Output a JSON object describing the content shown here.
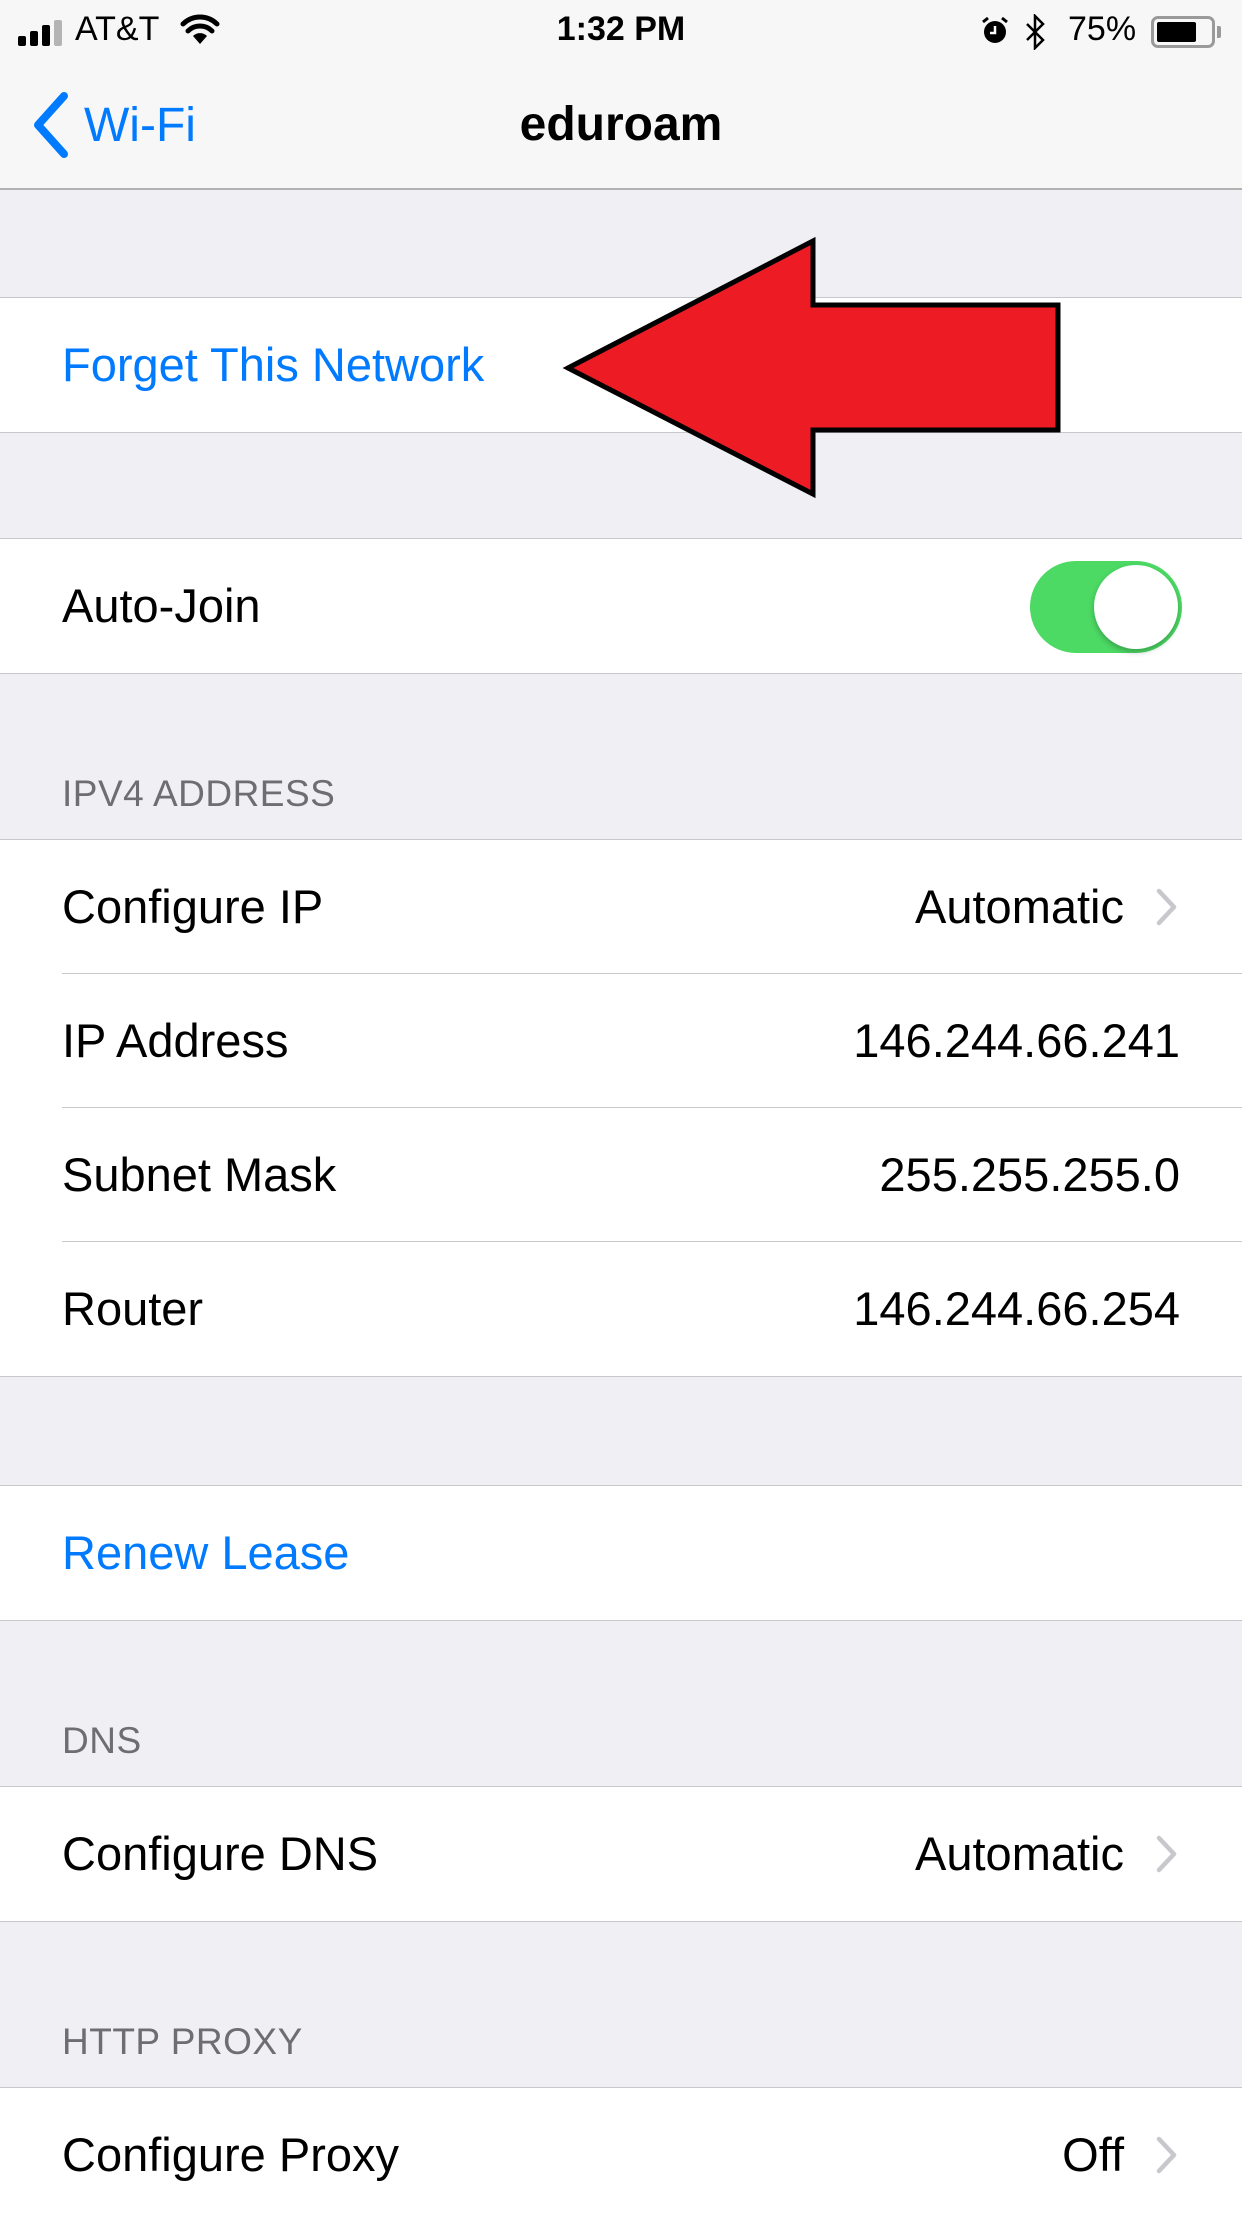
{
  "status_bar": {
    "carrier": "AT&T",
    "time": "1:32 PM",
    "battery_percent": "75%",
    "signal_bars": 3,
    "signal_bars_total": 4,
    "battery_level": 0.75
  },
  "nav": {
    "back_label": "Wi-Fi",
    "title": "eduroam"
  },
  "actions": {
    "forget_network": "Forget This Network",
    "renew_lease": "Renew Lease"
  },
  "auto_join": {
    "label": "Auto-Join",
    "enabled": true
  },
  "ipv4": {
    "header": "IPV4 ADDRESS",
    "rows": [
      {
        "label": "Configure IP",
        "value": "Automatic"
      },
      {
        "label": "IP Address",
        "value": "146.244.66.241"
      },
      {
        "label": "Subnet Mask",
        "value": "255.255.255.0"
      },
      {
        "label": "Router",
        "value": "146.244.66.254"
      }
    ]
  },
  "dns": {
    "header": "DNS",
    "rows": [
      {
        "label": "Configure DNS",
        "value": "Automatic"
      }
    ]
  },
  "http_proxy": {
    "header": "HTTP PROXY",
    "rows": [
      {
        "label": "Configure Proxy",
        "value": "Off"
      }
    ]
  },
  "annotation": {
    "icon": "red-arrow-icon",
    "color": "#ed1c24"
  },
  "colors": {
    "accent": "#007aff",
    "toggle_on": "#4cd964",
    "background": "#efeff4"
  }
}
